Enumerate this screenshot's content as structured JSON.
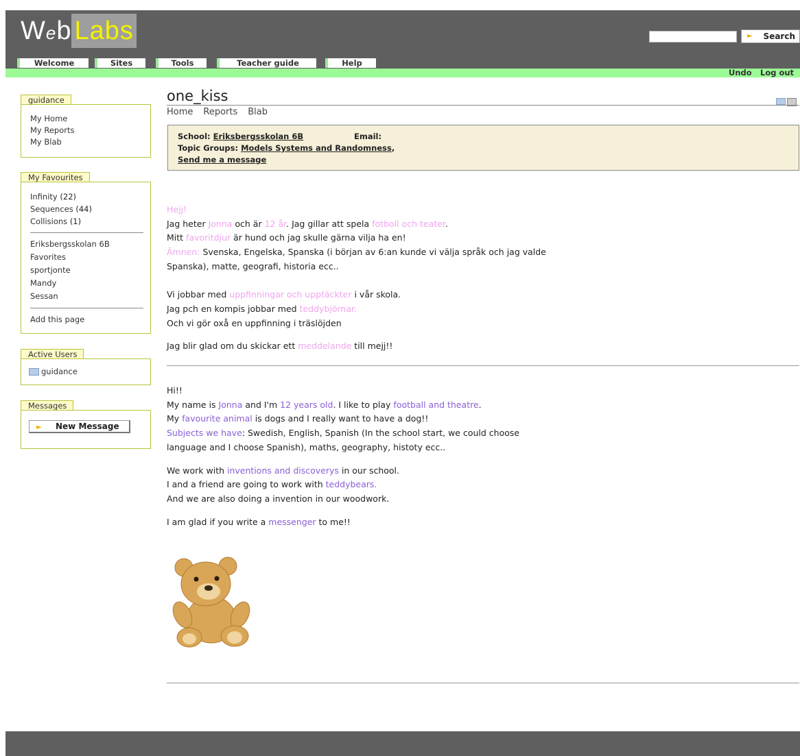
{
  "logo": {
    "web_w": "W",
    "web_e": "e",
    "web_b": "b",
    "labs": "Labs"
  },
  "search": {
    "placeholder": "",
    "button_label": "Search"
  },
  "tabs": [
    "Welcome",
    "Sites",
    "Tools",
    "Teacher guide",
    "Help"
  ],
  "top_links": {
    "undo": "Undo",
    "logout": "Log out"
  },
  "sidebar": {
    "guidance": {
      "title": "guidance",
      "items": [
        "My Home",
        "My Reports",
        "My Blab"
      ]
    },
    "favourites": {
      "title": "My Favourites",
      "counted": [
        {
          "label": "Infinity",
          "count": "(22)"
        },
        {
          "label": "Sequences",
          "count": "(44)"
        },
        {
          "label": "Collisions",
          "count": "(1)"
        }
      ],
      "items": [
        "Eriksbergsskolan 6B",
        "Favorites",
        "sportjonte",
        "Mandy",
        "Sessan"
      ],
      "add_label": "Add this page"
    },
    "active_users": {
      "title": "Active Users",
      "user": "guidance"
    },
    "messages": {
      "title": "Messages",
      "button_label": "New Message"
    }
  },
  "page": {
    "title": "one_kiss",
    "subnav": [
      "Home",
      "Reports",
      "Blab"
    ],
    "info": {
      "school_label": "School:",
      "school_value": "Eriksbergsskolan 6B",
      "email_label": "Email:",
      "topics_label": "Topic Groups:",
      "topics_value": "Models Systems and Randomness",
      "topics_suffix": ",",
      "send_message": "Send me a message"
    }
  },
  "content": {
    "swedish": {
      "greeting": "Hejj!",
      "l1": [
        "Jag heter ",
        "Jonna",
        "  och är ",
        "12 år",
        ". Jag gillar att spela ",
        "fotboll och teater",
        "."
      ],
      "l2": [
        "Mitt ",
        "favoritdjur",
        " är hund och jag skulle gärna vilja ha en!"
      ],
      "l3": [
        "Ämnen:",
        " Svenska, Engelska, Spanska (i början av 6:an kunde vi välja språk och jag valde"
      ],
      "l4": "Spanska), matte, geografi, historia ecc..",
      "l5": [
        "Vi jobbar med ",
        "uppfinningar och upptäckter",
        " i vår skola."
      ],
      "l6": [
        "Jag pch en kompis jobbar med ",
        "teddybjörnar."
      ],
      "l7": "Och vi gör oxå en uppfinning i träslöjden",
      "l8": [
        "Jag blir glad om du skickar ett ",
        "meddelande",
        " till mejj!!"
      ]
    },
    "english": {
      "greeting": "Hi!!",
      "l1": [
        "My name is ",
        "Jonna",
        " and I'm ",
        "12 years old",
        ". I like to play ",
        "football and theatre",
        "."
      ],
      "l2": [
        "My ",
        "favourite animal",
        " is dogs and I really want to have a dog!!"
      ],
      "l3": [
        "Subjects we have",
        ": Swedish, English, Spanish (In the school start, we could choose"
      ],
      "l4": "language and I choose Spanish), maths, geography, histoty ecc..",
      "l5": [
        "We work with ",
        "inventions and discoverys",
        " in our school."
      ],
      "l6": [
        "I and a friend are going to work with ",
        "teddybears."
      ],
      "l7": "And we are also doing a invention in our woodwork.",
      "l8": [
        "I am glad if you write a ",
        "messenger",
        " to me!!"
      ]
    }
  },
  "colors": {
    "header": "#5f5f5f",
    "green_bar": "#9bfa95",
    "pink_link": "#f0a4f0",
    "purple_link": "#8a5fd6",
    "box_border": "#b9c43c"
  }
}
